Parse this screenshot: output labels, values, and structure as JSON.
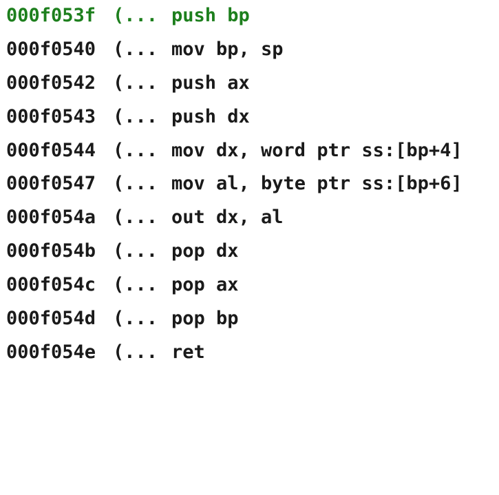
{
  "disassembly": {
    "current_color": "#1d7f1d",
    "text_color": "#1a1a1a",
    "rows": [
      {
        "address": "000f053f",
        "marker": "(...",
        "instruction": "push bp",
        "current": true
      },
      {
        "address": "000f0540",
        "marker": "(...",
        "instruction": "mov bp, sp",
        "current": false
      },
      {
        "address": "000f0542",
        "marker": "(...",
        "instruction": "push ax",
        "current": false
      },
      {
        "address": "000f0543",
        "marker": "(...",
        "instruction": "push dx",
        "current": false
      },
      {
        "address": "000f0544",
        "marker": "(...",
        "instruction": "mov dx, word ptr ss:[bp+4]",
        "current": false
      },
      {
        "address": "000f0547",
        "marker": "(...",
        "instruction": "mov al, byte ptr ss:[bp+6]",
        "current": false
      },
      {
        "address": "000f054a",
        "marker": "(...",
        "instruction": "out dx, al",
        "current": false
      },
      {
        "address": "000f054b",
        "marker": "(...",
        "instruction": "pop dx",
        "current": false
      },
      {
        "address": "000f054c",
        "marker": "(...",
        "instruction": "pop ax",
        "current": false
      },
      {
        "address": "000f054d",
        "marker": "(...",
        "instruction": "pop bp",
        "current": false
      },
      {
        "address": "000f054e",
        "marker": "(...",
        "instruction": "ret",
        "current": false
      }
    ]
  }
}
